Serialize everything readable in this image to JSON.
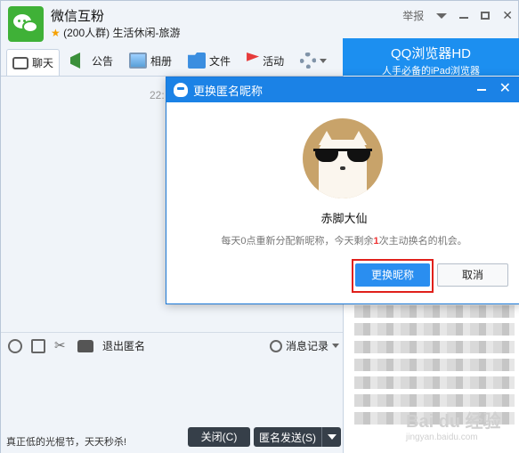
{
  "window": {
    "group_name": "微信互粉",
    "group_subtitle": "(200人群) 生活休闲-旅游",
    "report_label": "举报"
  },
  "toolbar": {
    "chat": "聊天",
    "notice": "公告",
    "album": "相册",
    "file": "文件",
    "activity": "活动"
  },
  "ad": {
    "title": "QQ浏览器HD",
    "subtitle": "人手必备的iPad浏览器"
  },
  "chat": {
    "time_hint": "22:"
  },
  "input_toolbar": {
    "exit_anonymous": "退出匿名",
    "history": "消息记录"
  },
  "footer": {
    "promo": "真正低的光棍节，天天秒杀!",
    "close_button": "关闭(C)",
    "send_button": "匿名发送(S)"
  },
  "dialog": {
    "title": "更换匿名昵称",
    "nickname": "赤脚大仙",
    "tip_prefix": "每天0点重新分配新昵称，今天剩余",
    "tip_count": "1",
    "tip_suffix": "次主动换名的机会。",
    "change_button": "更换昵称",
    "cancel_button": "取消"
  },
  "watermark": {
    "text": "Bai du 经验",
    "sub": "jingyan.baidu.com"
  },
  "colors": {
    "dialog_title_bg": "#1b82e6",
    "change_button_bg": "#2a8ef0",
    "highlight_border": "#e0201b",
    "wechat_green": "#3fb137"
  }
}
